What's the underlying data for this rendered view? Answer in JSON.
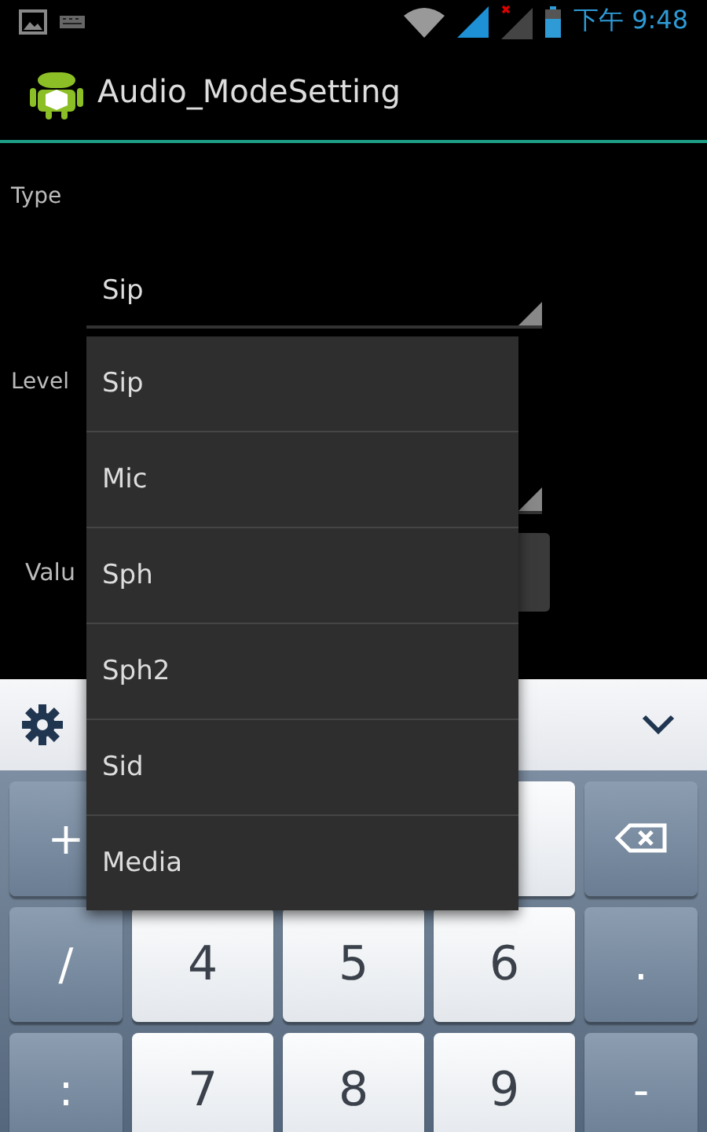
{
  "status_bar": {
    "time": "下午 9:48"
  },
  "app_bar": {
    "title": "Audio_ModeSetting"
  },
  "form": {
    "rows": [
      {
        "kind": "spinner",
        "label": "Type",
        "value": "Sip"
      },
      {
        "kind": "spinner",
        "label": "Level"
      },
      {
        "kind": "button",
        "label": "Valu"
      }
    ]
  },
  "dropdown": {
    "items": [
      {
        "label": "Sip"
      },
      {
        "label": "Mic"
      },
      {
        "label": "Sph"
      },
      {
        "label": "Sph2"
      },
      {
        "label": "Sid"
      },
      {
        "label": "Media"
      }
    ]
  },
  "keyboard": {
    "rows": [
      [
        {
          "kind": "fn",
          "label": "+"
        },
        {
          "kind": "hidden"
        },
        {
          "kind": "hidden"
        },
        {
          "kind": "digit"
        },
        {
          "kind": "backspace"
        }
      ],
      [
        {
          "kind": "fn",
          "label": "/"
        },
        {
          "kind": "digit",
          "label": "4"
        },
        {
          "kind": "digit",
          "label": "5"
        },
        {
          "kind": "digit",
          "label": "6"
        },
        {
          "kind": "fn",
          "label": "."
        }
      ],
      [
        {
          "kind": "fn",
          "label": ":"
        },
        {
          "kind": "digit",
          "label": "7"
        },
        {
          "kind": "digit",
          "label": "8"
        },
        {
          "kind": "digit",
          "label": "9"
        },
        {
          "kind": "fn",
          "label": "-"
        }
      ]
    ]
  }
}
